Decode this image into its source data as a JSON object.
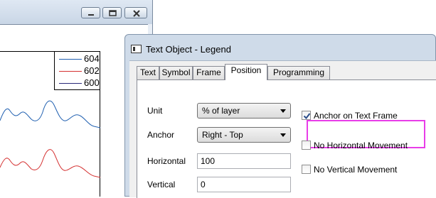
{
  "graph": {
    "legend": [
      {
        "label": "604",
        "color": "#1f5fb0"
      },
      {
        "label": "602",
        "color": "#d43030"
      },
      {
        "label": "600",
        "color": "#2a2a7a"
      }
    ]
  },
  "dialog": {
    "title": "Text Object - Legend",
    "tabs": [
      {
        "label": "Text",
        "active": false
      },
      {
        "label": "Symbol",
        "active": false
      },
      {
        "label": "Frame",
        "active": false
      },
      {
        "label": "Position",
        "active": true
      },
      {
        "label": "Programming",
        "active": false
      }
    ],
    "fields": {
      "unit": {
        "label": "Unit",
        "value": "% of layer"
      },
      "anchor": {
        "label": "Anchor",
        "value": "Right - Top"
      },
      "horizontal": {
        "label": "Horizontal",
        "value": "100"
      },
      "vertical": {
        "label": "Vertical",
        "value": "0"
      }
    },
    "checkboxes": {
      "anchor_on_text_frame": {
        "label": "Anchor on Text Frame",
        "checked": true
      },
      "no_horizontal_movement": {
        "label": "No Horizontal Movement",
        "checked": false
      },
      "no_vertical_movement": {
        "label": "No Vertical Movement",
        "checked": false
      }
    },
    "highlight_color": "#e83de8"
  }
}
